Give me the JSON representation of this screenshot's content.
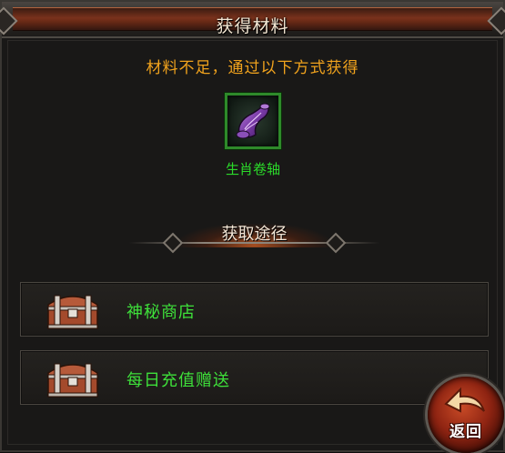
{
  "dialog": {
    "title": "获得材料",
    "hint": "材料不足，通过以下方式获得"
  },
  "item": {
    "name": "生肖卷轴",
    "icon": "purple-scroll-icon",
    "name_color": "#2bd92a"
  },
  "sources": {
    "heading": "获取途径",
    "items": [
      {
        "label": "神秘商店",
        "icon": "treasure-chest-icon"
      },
      {
        "label": "每日充值赠送",
        "icon": "treasure-chest-icon"
      }
    ]
  },
  "buttons": {
    "return_label": "返回",
    "return_icon": "back-arrow-icon"
  },
  "colors": {
    "hint": "#f0a21d",
    "source_label": "#3ee03a",
    "title_plate": "#7a321c"
  }
}
